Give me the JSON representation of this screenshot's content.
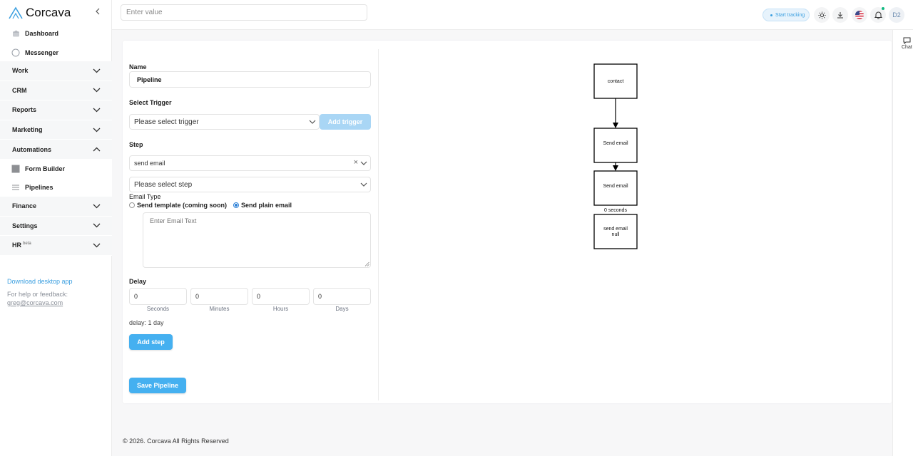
{
  "brand": {
    "name": "Corcava"
  },
  "sidebar": {
    "top_links": [
      {
        "label": "Dashboard",
        "icon": "home-icon"
      },
      {
        "label": "Messenger",
        "icon": "chat-icon"
      }
    ],
    "groups": [
      {
        "label": "Work"
      },
      {
        "label": "CRM"
      },
      {
        "label": "Reports"
      },
      {
        "label": "Marketing"
      },
      {
        "label": "Automations"
      },
      {
        "label": "Finance"
      },
      {
        "label": "Settings"
      },
      {
        "label": "HR",
        "badge": "beta"
      }
    ],
    "automations_sub": [
      {
        "label": "Form Builder"
      },
      {
        "label": "Pipelines"
      }
    ],
    "download_link": "Download desktop app",
    "help_text": "For help or feedback:",
    "help_email": "greg@corcava.com"
  },
  "header": {
    "search_placeholder": "Enter value",
    "track_label": "Start tracking",
    "avatar_initials": "D2"
  },
  "chat": {
    "label": "Chat"
  },
  "form": {
    "name_label": "Name",
    "name_value": "Pipeline",
    "trigger_label": "Select Trigger",
    "trigger_placeholder": "Please select trigger",
    "add_trigger": "Add trigger",
    "step_label": "Step",
    "step_value": "send email",
    "step_placeholder": "Please select step",
    "email_type_label": "Email Type",
    "email_type_options": [
      {
        "label": "Send template (coming soon)",
        "selected": false
      },
      {
        "label": "Send plain email",
        "selected": true
      }
    ],
    "email_text_placeholder": "Enter Email Text",
    "delay_label": "Delay",
    "delay_fields": [
      {
        "value": "0",
        "caption": "Seconds"
      },
      {
        "value": "0",
        "caption": "Minutes"
      },
      {
        "value": "0",
        "caption": "Hours"
      },
      {
        "value": "0",
        "caption": "Days"
      }
    ],
    "delay_summary": "delay: 1 day",
    "add_step": "Add step",
    "save_pipeline": "Save Pipeline"
  },
  "flow": {
    "nodes": [
      {
        "lines": [
          "contact"
        ]
      },
      {
        "lines": [
          "Send email"
        ]
      },
      {
        "lines": [
          "Send email"
        ]
      },
      {
        "lines": [
          "send email",
          "null"
        ]
      }
    ],
    "edge_label": "0 seconds"
  },
  "footer": {
    "copyright": "© 2026. Corcava All Rights Reserved"
  }
}
